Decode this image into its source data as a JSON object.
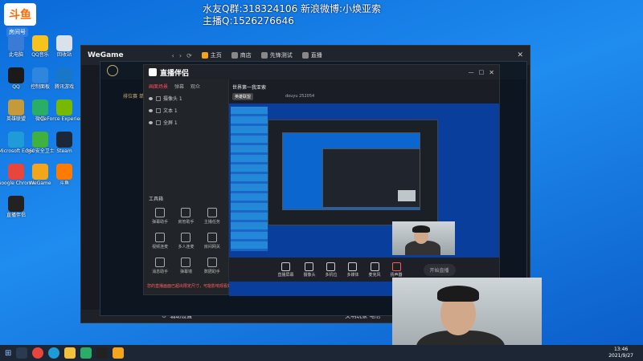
{
  "overlay": {
    "logo_text": "斗鱼",
    "room_number": "房间号",
    "line1": "水友Q群:318324106 新浪微博:小焕亚索",
    "line2": "主播Q:1526276646"
  },
  "desktop_icons": [
    {
      "label": "此电脑",
      "color": "#3a7bd5"
    },
    {
      "label": "QQ音乐",
      "color": "#f6c21c"
    },
    {
      "label": "回收站",
      "color": "#d9e2ea"
    },
    {
      "label": "QQ",
      "color": "#1a1a1a"
    },
    {
      "label": "控制面板",
      "color": "#2e86de"
    },
    {
      "label": "腾讯游戏",
      "color": "#1877c9"
    },
    {
      "label": "英雄联盟",
      "color": "#c59a3a"
    },
    {
      "label": "微信",
      "color": "#2aae67"
    },
    {
      "label": "GeForce Experience",
      "color": "#76b900"
    },
    {
      "label": "Microsoft Edge",
      "color": "#1f9bd8"
    },
    {
      "label": "360安全卫士",
      "color": "#3fb13f"
    },
    {
      "label": "Steam",
      "color": "#1b2838"
    },
    {
      "label": "Google Chrome",
      "color": "#e8453c"
    },
    {
      "label": "WeGame",
      "color": "#f3a51b"
    },
    {
      "label": "斗鱼",
      "color": "#ff7b00"
    },
    {
      "label": "直播伴侣",
      "color": "#222"
    }
  ],
  "wegame": {
    "title": "WeGame",
    "tabs": [
      "主页",
      "商店",
      "先锋测试",
      "直播"
    ],
    "footer_link": "辅助设置",
    "footer_status": "文明玩家 电信"
  },
  "lol_client": {
    "mode": "排位赛 单"
  },
  "zbpl": {
    "title": "直播伴侣",
    "scene_tabs": [
      "画面场景",
      "弹幕",
      "观众"
    ],
    "room_title": "世界第一我亚索",
    "room_badge": "英雄联盟",
    "room_meta": "douyu 252054",
    "sources": [
      "摄像头 1",
      "文本 1",
      "全屏 1"
    ],
    "tools_title": "工具箱",
    "tools": [
      "弹幕助手",
      "房管助手",
      "主播任务",
      "视频连麦",
      "多人连麦",
      "房间网关",
      "消息助手",
      "弹幕墙",
      "数据助手"
    ],
    "bottom_bar": [
      "直播屏幕",
      "摄像头",
      "多机位",
      "多媒体",
      "麦克风",
      "扬声器"
    ],
    "start_button": "开始直播",
    "warning": "您的直播画面已超出限定尺寸，可能影响观看效果"
  },
  "taskbar": {
    "time": "13:46",
    "date": "2021/9/27"
  }
}
